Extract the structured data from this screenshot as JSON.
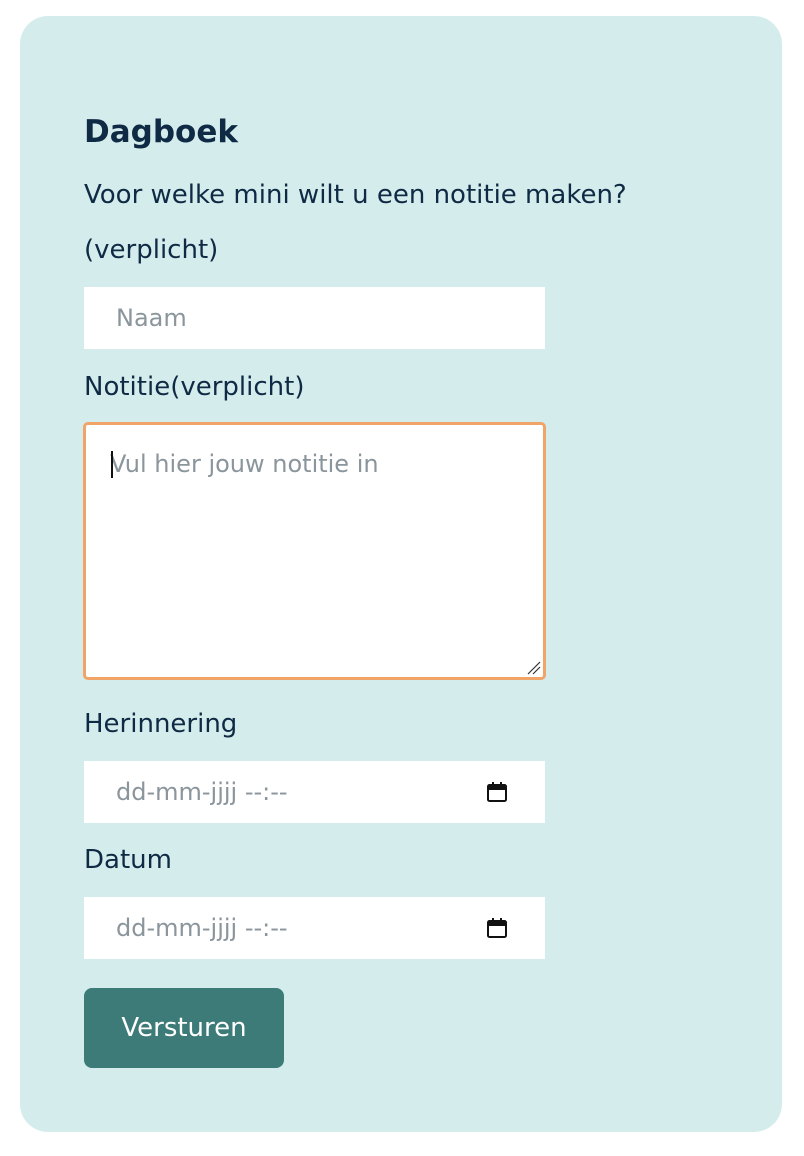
{
  "form": {
    "title": "Dagboek",
    "question_line1": "Voor welke mini wilt u een notitie maken?",
    "question_line2": "(verplicht)",
    "name_placeholder": "Naam",
    "note_label": "Notitie(verplicht)",
    "note_placeholder": "Vul hier jouw notitie in",
    "reminder_label": "Herinnering",
    "reminder_placeholder": "dd-mm-jjjj --:--",
    "date_label": "Datum",
    "date_placeholder": "dd-mm-jjjj --:--",
    "submit_label": "Versturen"
  },
  "colors": {
    "card_background": "#d5ecec",
    "text": "#0f2a44",
    "focus_border": "#f0a468",
    "button": "#3c7b78"
  },
  "icons": {
    "calendar": "calendar-icon",
    "resize": "resize-handle-icon"
  }
}
